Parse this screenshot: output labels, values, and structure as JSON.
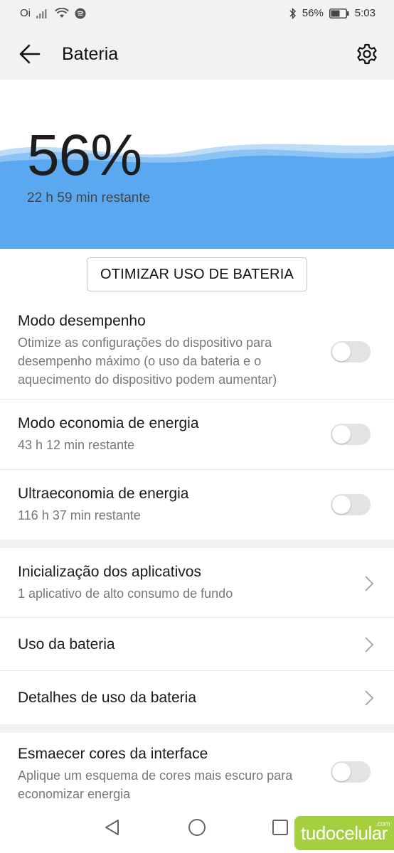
{
  "status_bar": {
    "carrier": "Oi",
    "battery_text": "56%",
    "time": "5:03",
    "icons": [
      "signal-icon",
      "wifi-icon",
      "spotify-icon",
      "bluetooth-icon",
      "battery-icon"
    ]
  },
  "header": {
    "title": "Bateria",
    "back_icon": "arrow-left-icon",
    "settings_icon": "gear-icon"
  },
  "battery": {
    "percent_text": "56%",
    "level": 0.56,
    "remaining": "22 h 59 min restante",
    "wave_color": "#5aa9f0"
  },
  "optimize_button": "OTIMIZAR USO DE BATERIA",
  "modes": [
    {
      "title": "Modo desempenho",
      "subtitle": "Otimize as configurações do dispositivo para desempenho máximo (o uso da bateria e o aquecimento do dispositivo podem aumentar)",
      "enabled": false
    },
    {
      "title": "Modo economia de energia",
      "subtitle": "43 h 12 min restante",
      "enabled": false
    },
    {
      "title": "Ultraeconomia de energia",
      "subtitle": "116 h 37 min restante",
      "enabled": false
    }
  ],
  "links": [
    {
      "title": "Inicialização dos aplicativos",
      "subtitle": "1 aplicativo de alto consumo de fundo"
    },
    {
      "title": "Uso da bateria"
    },
    {
      "title": "Detalhes de uso da bateria"
    }
  ],
  "dim_colors": {
    "title": "Esmaecer cores da interface",
    "subtitle": "Aplique um esquema de cores mais escuro para economizar energia",
    "enabled": false
  },
  "watermark": {
    "text": "tudocelular",
    "suffix": ".com",
    "color": "#a6cf3f"
  }
}
